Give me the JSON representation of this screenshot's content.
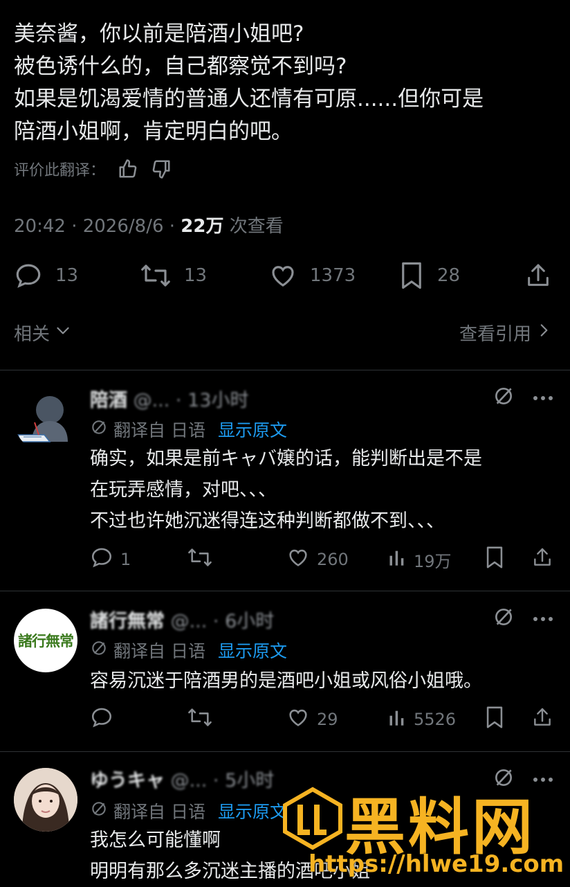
{
  "tweet": {
    "lines": [
      "美奈酱，你以前是陪酒小姐吧?",
      "被色诱什么的，自己都察觉不到吗?",
      "如果是饥渴爱情的普通人还情有可原......但你可是",
      "陪酒小姐啊，肯定明白的吧。"
    ],
    "rate_label": "评价此翻译：",
    "time": "20:42 · 2026/8/6 · ",
    "views": "22万",
    "views_suffix": " 次查看",
    "replies": "13",
    "retweets": "13",
    "likes": "1373",
    "bookmarks": "28",
    "related": "相关",
    "view_quotes": "查看引用"
  },
  "replies": [
    {
      "name": "陪酒",
      "handle_blur": "@...  · 13小时",
      "translated_from": "翻译自 日语",
      "show_original": "显示原文",
      "lines": [
        "确实，如果是前キャバ嬢的话，能判断出是不是",
        "在玩弄感情，对吧、、、",
        "不过也许她沉迷得连这种判断都做不到、、、"
      ],
      "replies": "1",
      "retweets": "",
      "likes": "260",
      "views": "19万"
    },
    {
      "name": "諸行無常",
      "handle_blur": "@...  · 6小时",
      "avatar_text": "諸行無常",
      "translated_from": "翻译自 日语",
      "show_original": "显示原文",
      "lines": [
        "容易沉迷于陪酒男的是酒吧小姐或风俗小姐哦。"
      ],
      "replies": "",
      "retweets": "",
      "likes": "29",
      "views": "5526"
    },
    {
      "name": "ゆうキャ",
      "handle_blur": "@...  · 5小时",
      "translated_from": "翻译自 日语",
      "show_original": "显示原文",
      "lines": [
        "我怎么可能懂啊",
        "明明有那么多沉迷主播的酒吧小姐"
      ]
    }
  ],
  "watermark": {
    "text": "黑料网",
    "url": "https://hlwe19.com"
  },
  "colors": {
    "background": "#000000",
    "text": "#e7e9ea",
    "muted": "#71767b",
    "link": "#1d9bf0",
    "divider": "#2f3336",
    "watermark": "#f6b322"
  }
}
